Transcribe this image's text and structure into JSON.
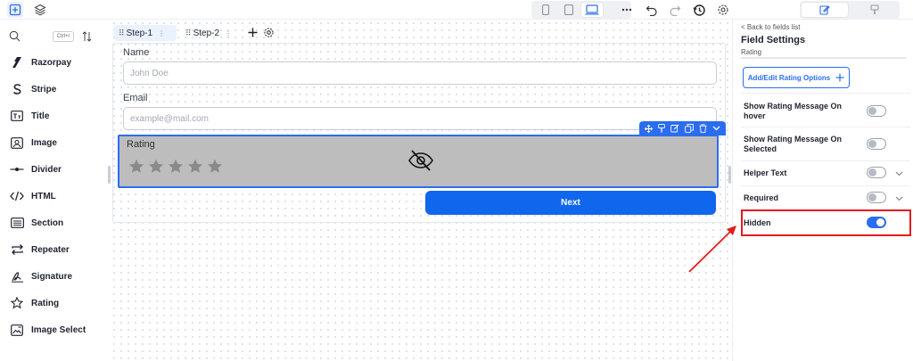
{
  "topbar": {
    "left_icons": [
      "add-element-icon",
      "layers-icon"
    ],
    "devices": [
      "mobile",
      "tablet",
      "desktop"
    ],
    "active_device": "desktop",
    "actions": [
      "more-icon",
      "undo-icon",
      "redo-icon",
      "history-icon",
      "settings-icon"
    ],
    "right_tabs": [
      "edit-icon",
      "paint-icon"
    ],
    "active_right_tab": "edit"
  },
  "sidebar": {
    "search_shortcut": "Ctrl+/",
    "items": [
      {
        "label": "Razorpay",
        "icon": "razorpay-icon"
      },
      {
        "label": "Stripe",
        "icon": "stripe-icon"
      },
      {
        "label": "Title",
        "icon": "title-icon"
      },
      {
        "label": "Image",
        "icon": "image-icon"
      },
      {
        "label": "Divider",
        "icon": "divider-icon"
      },
      {
        "label": "HTML",
        "icon": "code-icon"
      },
      {
        "label": "Section",
        "icon": "section-icon"
      },
      {
        "label": "Repeater",
        "icon": "repeater-icon"
      },
      {
        "label": "Signature",
        "icon": "signature-icon"
      },
      {
        "label": "Rating",
        "icon": "star-icon"
      },
      {
        "label": "Image Select",
        "icon": "image-select-icon"
      }
    ]
  },
  "canvas": {
    "steps": [
      {
        "label": "Step-1",
        "active": true
      },
      {
        "label": "Step-2",
        "active": false
      }
    ],
    "fields": {
      "name": {
        "label": "Name",
        "placeholder": "John Doe"
      },
      "email": {
        "label": "Email",
        "placeholder": "example@mail.com"
      },
      "rating": {
        "label": "Rating",
        "stars": 5,
        "hidden": true
      }
    },
    "next_label": "Next"
  },
  "panel": {
    "back_label": "< Back to fields list",
    "title": "Field Settings",
    "subtitle": "Rating",
    "add_options_label": "Add/Edit Rating Options",
    "rows": [
      {
        "label": "Show Rating Message On hover",
        "on": false,
        "expandable": false
      },
      {
        "label": "Show Rating Message On Selected",
        "on": false,
        "expandable": false
      },
      {
        "label": "Helper Text",
        "on": false,
        "expandable": true
      },
      {
        "label": "Required",
        "on": false,
        "expandable": true
      },
      {
        "label": "Hidden",
        "on": true,
        "expandable": false
      }
    ]
  },
  "colors": {
    "accent": "#2b6df0",
    "next_button": "#1166ee",
    "highlight": "#e41b1b",
    "rating_bg": "#bdbdbd"
  }
}
